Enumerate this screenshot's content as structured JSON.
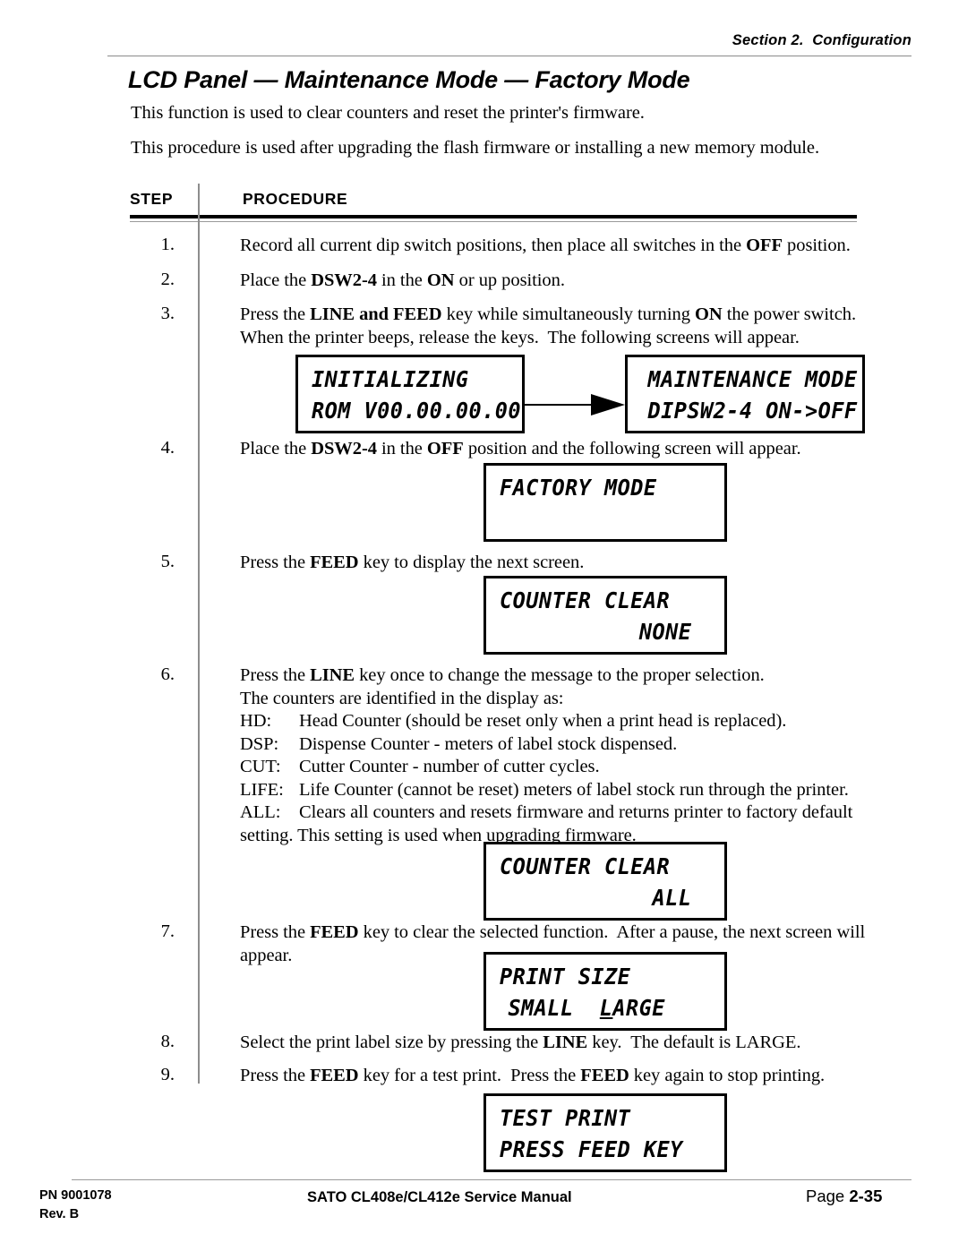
{
  "header": {
    "section_label": "Section 2.  Configuration",
    "title": "LCD Panel — Maintenance Mode — Factory Mode"
  },
  "intro": {
    "para1": "This function is used to clear counters and reset the printer's firmware.",
    "para2": "This procedure is used after upgrading the flash firmware or installing a new memory module."
  },
  "table": {
    "col_step": "STEP",
    "col_procedure": "PROCEDURE"
  },
  "steps": [
    {
      "num": "1.",
      "text": "Record all current dip switch positions, then place all switches in the OFF position."
    },
    {
      "num": "2.",
      "text": "Place the DSW2-4 in the ON or up position."
    },
    {
      "num": "3.",
      "line1": "Press the LINE and FEED key while simultaneously turning ON the power switch.",
      "line2": "When the printer beeps, release the keys.  The following screens will appear."
    },
    {
      "num": "4.",
      "text": "Place the DSW2-4 in the OFF position and the following screen will appear."
    },
    {
      "num": "5.",
      "text": "Press the FEED key to display the next screen."
    },
    {
      "num": "6.",
      "line1": "Press the LINE key once to change the message to the proper selection.",
      "line2": "The counters are identified in the display as:",
      "counters": [
        {
          "key": "HD:",
          "desc": "Head Counter (should be reset only when a print head is replaced)."
        },
        {
          "key": "DSP:",
          "desc": "Dispense Counter - meters of label stock dispensed."
        },
        {
          "key": "CUT:",
          "desc": "Cutter Counter - number of cutter cycles."
        },
        {
          "key": "LIFE:",
          "desc": "Life Counter (cannot be reset) meters of label stock run through the printer."
        },
        {
          "key": "ALL:",
          "desc": "Clears all counters and resets firmware and returns printer to factory default"
        }
      ],
      "line_last": "setting.  This setting is used when upgrading firmware."
    },
    {
      "num": "7.",
      "line1": "Press the FEED key to clear the selected function.  After a pause, the next screen will",
      "line2": "appear."
    },
    {
      "num": "8.",
      "text": "Select the print label size by pressing the LINE key.  The default is LARGE."
    },
    {
      "num": "9.",
      "text": "Press the FEED key for a test print.  Press the FEED key again to stop printing."
    }
  ],
  "lcd_screens": [
    {
      "id": "initializing",
      "row1": "INITIALIZING",
      "row2": "ROM V00.00.00.00"
    },
    {
      "id": "maintenance-mode",
      "row1": "MAINTENANCE MODE",
      "row2": "DIPSW2-4 ON->OFF"
    },
    {
      "id": "factory-mode",
      "row1": "FACTORY MODE",
      "row2": ""
    },
    {
      "id": "counter-clear-none",
      "row1": "COUNTER CLEAR",
      "row2": "NONE"
    },
    {
      "id": "counter-clear-all",
      "row1": "COUNTER CLEAR",
      "row2": "ALL"
    },
    {
      "id": "print-size",
      "row1": "PRINT SIZE",
      "row2_small": "SMALL",
      "row2_cursor": "L",
      "row2_rest": "ARGE"
    },
    {
      "id": "test-print",
      "row1": "TEST PRINT",
      "row2": "PRESS FEED KEY"
    }
  ],
  "footer": {
    "pn": "PN 9001078",
    "rev": "Rev. B",
    "manual": "SATO CL408e/CL412e Service Manual",
    "page_label": "Page",
    "page_number": "2-35"
  }
}
